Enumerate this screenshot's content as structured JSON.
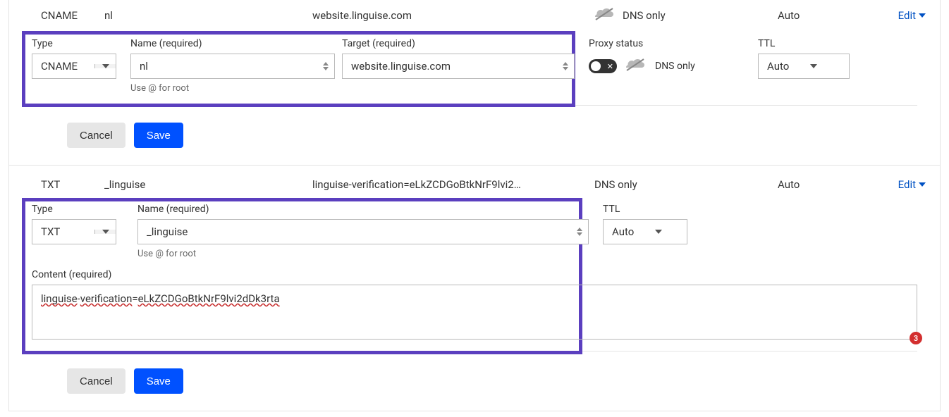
{
  "labels": {
    "type": "Type",
    "name_required": "Name (required)",
    "target_required": "Target (required)",
    "content_required": "Content (required)",
    "use_at_root": "Use @ for root",
    "proxy_status": "Proxy status",
    "ttl": "TTL",
    "dns_only": "DNS only",
    "edit": "Edit",
    "cancel": "Cancel",
    "save": "Save",
    "auto": "Auto"
  },
  "records": [
    {
      "summary": {
        "type": "CNAME",
        "name": "nl",
        "target": "website.linguise.com",
        "proxy": "DNS only",
        "ttl": "Auto"
      },
      "form": {
        "type": "CNAME",
        "name": "nl",
        "target": "website.linguise.com",
        "proxy": "DNS only",
        "ttl": "Auto"
      }
    },
    {
      "summary": {
        "type": "TXT",
        "name": "_linguise",
        "target": "linguise-verification=eLkZCDGoBtkNrF9lvi2…",
        "proxy": "DNS only",
        "ttl": "Auto"
      },
      "form": {
        "type": "TXT",
        "name": "_linguise",
        "content": "linguise-verification=eLkZCDGoBtkNrF9lvi2dDk3rta",
        "content_parts": {
          "p1": "linguise",
          "p2": "verification",
          "p3": "eLkZCDGoBtkNrF9lvi2dDk3rta"
        },
        "ttl": "Auto",
        "error_count": "3"
      }
    }
  ]
}
